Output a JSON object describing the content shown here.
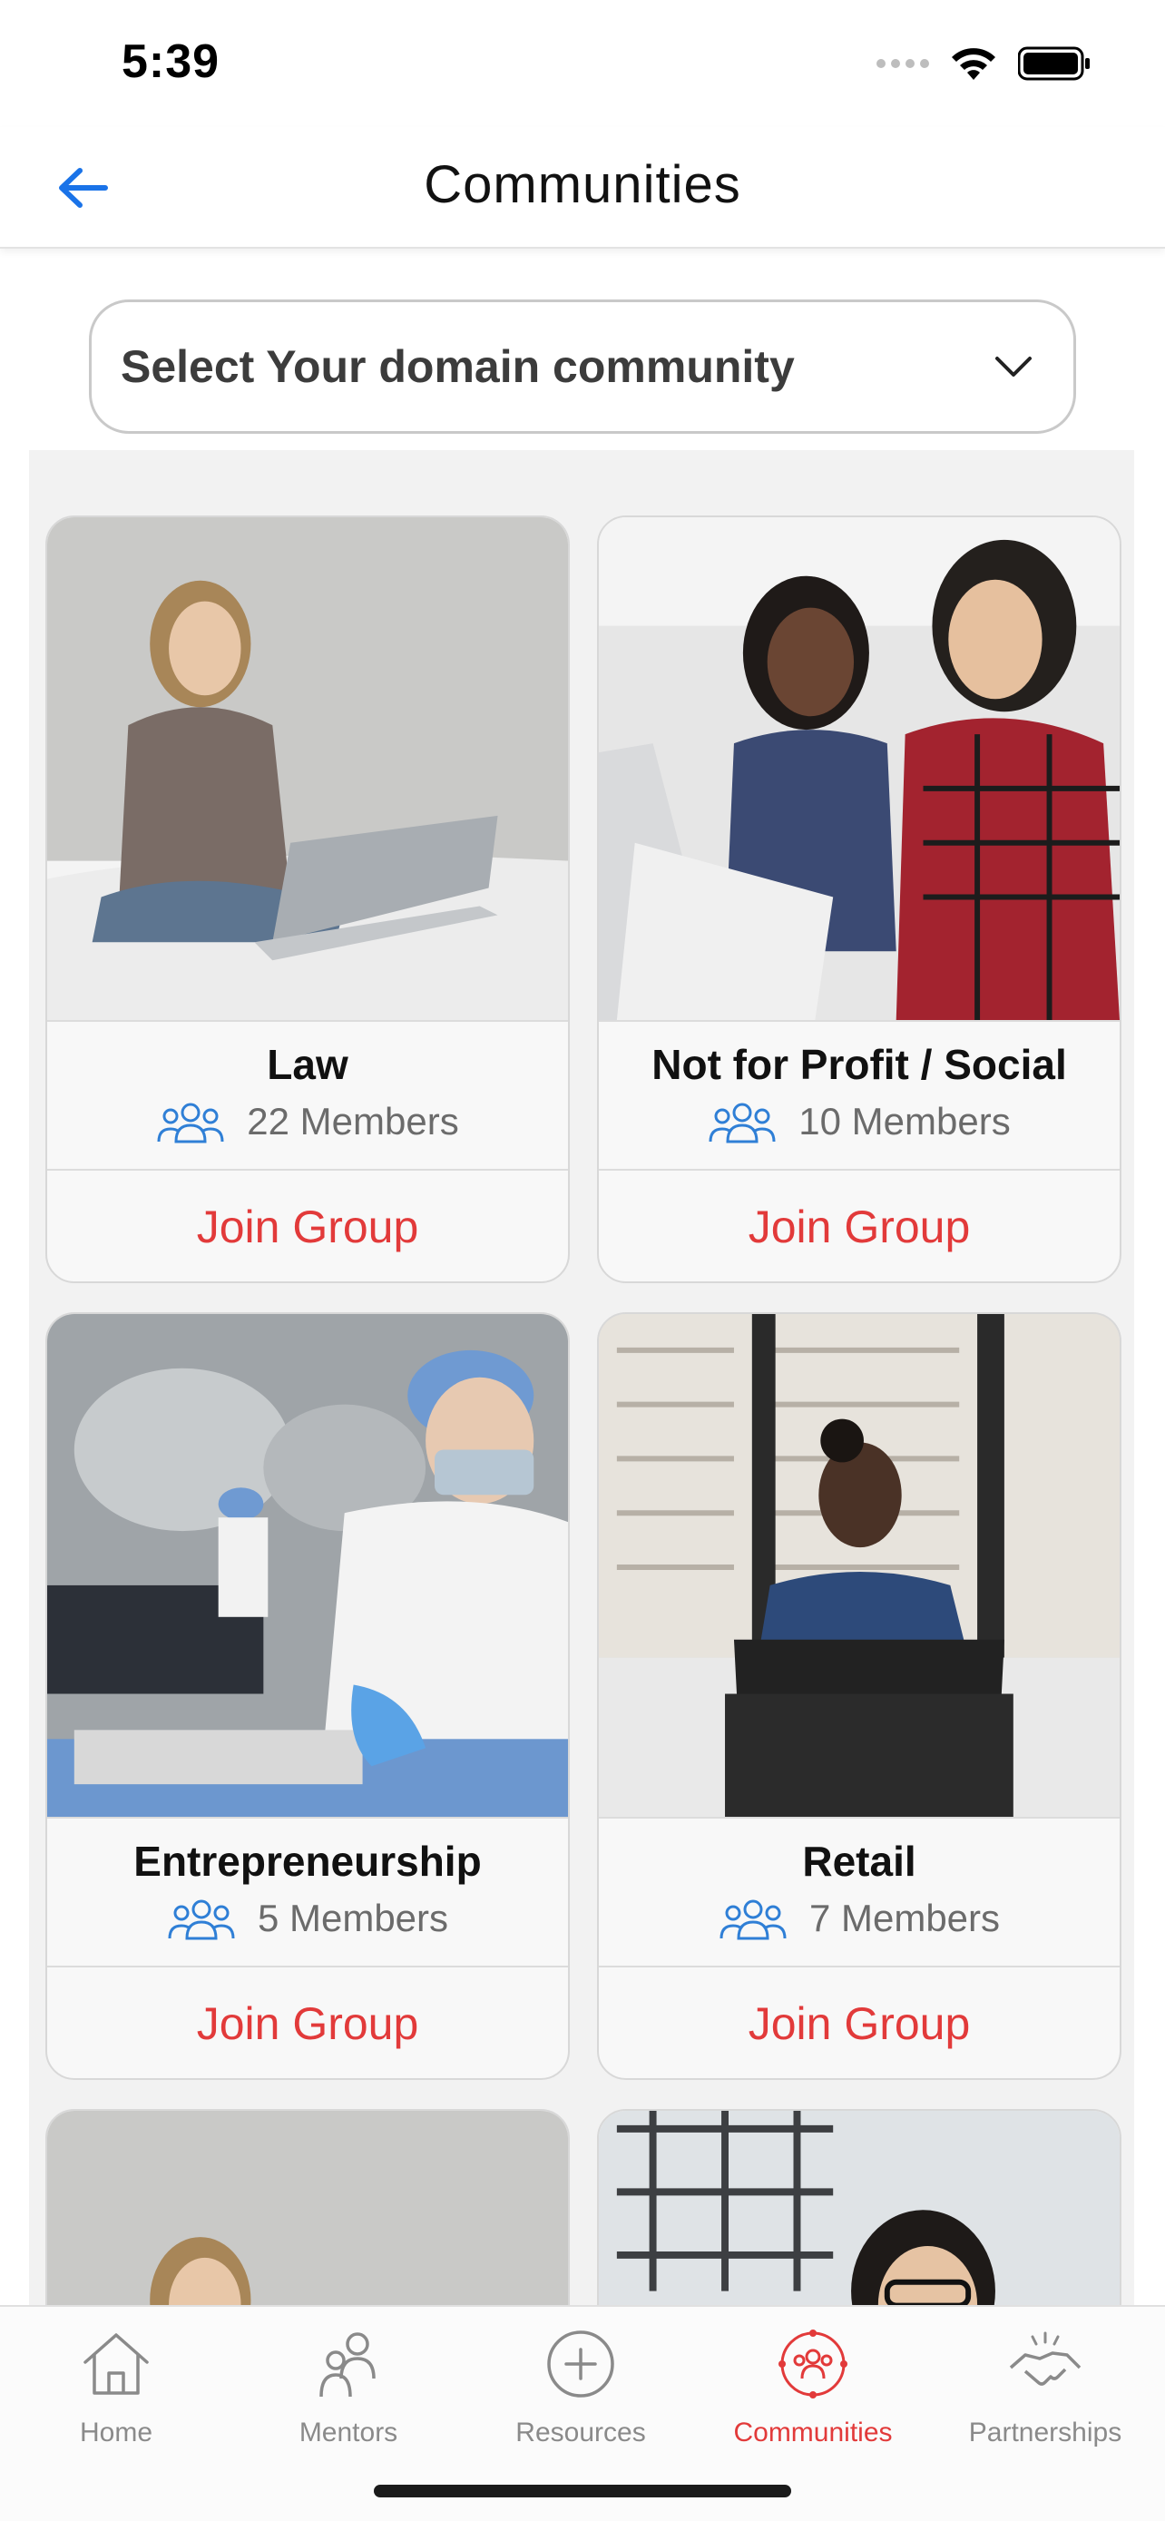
{
  "status_bar": {
    "time": "5:39"
  },
  "nav": {
    "title": "Communities"
  },
  "domain_select": {
    "label": "Select Your domain community"
  },
  "communities": [
    {
      "name": "Law",
      "members": "22 Members",
      "action": "Join Group"
    },
    {
      "name": "Not for Profit / Social",
      "members": "10 Members",
      "action": "Join Group"
    },
    {
      "name": "Entrepreneurship",
      "members": "5 Members",
      "action": "Join Group"
    },
    {
      "name": "Retail",
      "members": "7 Members",
      "action": "Join Group"
    }
  ],
  "tabs": [
    {
      "label": "Home",
      "icon": "home-icon",
      "active": false
    },
    {
      "label": "Mentors",
      "icon": "mentors-icon",
      "active": false
    },
    {
      "label": "Resources",
      "icon": "plus-circle-icon",
      "active": false
    },
    {
      "label": "Communities",
      "icon": "communities-icon",
      "active": true
    },
    {
      "label": "Partnerships",
      "icon": "handshake-icon",
      "active": false
    }
  ],
  "colors": {
    "accent": "#e23a3a",
    "link": "#1a73e8",
    "members_icon": "#2f7fd6"
  }
}
